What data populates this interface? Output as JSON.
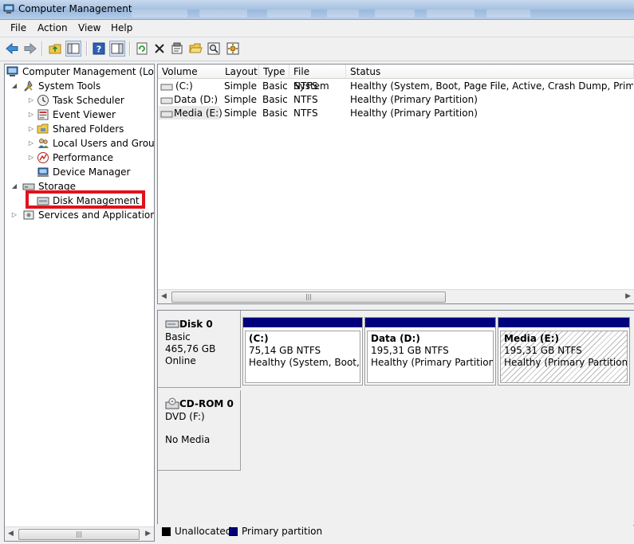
{
  "window": {
    "title": "Computer Management"
  },
  "menu": [
    "File",
    "Action",
    "View",
    "Help"
  ],
  "tree": {
    "root": "Computer Management (Local",
    "system_tools": "System Tools",
    "task_scheduler": "Task Scheduler",
    "event_viewer": "Event Viewer",
    "shared_folders": "Shared Folders",
    "local_users": "Local Users and Groups",
    "performance": "Performance",
    "device_manager": "Device Manager",
    "storage": "Storage",
    "disk_management": "Disk Management",
    "services": "Services and Applications"
  },
  "volumes": {
    "columns": [
      "Volume",
      "Layout",
      "Type",
      "File System",
      "Status"
    ],
    "rows": [
      {
        "volume": "(C:)",
        "layout": "Simple",
        "type": "Basic",
        "fs": "NTFS",
        "status": "Healthy (System, Boot, Page File, Active, Crash Dump, Primary Part"
      },
      {
        "volume": "Data (D:)",
        "layout": "Simple",
        "type": "Basic",
        "fs": "NTFS",
        "status": "Healthy (Primary Partition)"
      },
      {
        "volume": "Media (E:)",
        "layout": "Simple",
        "type": "Basic",
        "fs": "NTFS",
        "status": "Healthy (Primary Partition)"
      }
    ]
  },
  "disks": [
    {
      "name": "Disk 0",
      "kind": "Basic",
      "size": "465,76 GB",
      "state": "Online",
      "partitions": [
        {
          "name": "(C:)",
          "size": "75,14 GB NTFS",
          "status": "Healthy (System, Boot, Pa"
        },
        {
          "name": "Data  (D:)",
          "size": "195,31 GB NTFS",
          "status": "Healthy (Primary Partition)"
        },
        {
          "name": "Media  (E:)",
          "size": "195,31 GB NTFS",
          "status": "Healthy (Primary Partition)"
        }
      ]
    },
    {
      "name": "CD-ROM 0",
      "kind": "DVD (F:)",
      "state": "No Media"
    }
  ],
  "legend": {
    "unallocated": "Unallocated",
    "primary": "Primary partition"
  },
  "colors": {
    "primary": "#00007c",
    "unallocated": "#000000",
    "highlight": "#e0131c",
    "titlebar": "#a9c3e2"
  }
}
